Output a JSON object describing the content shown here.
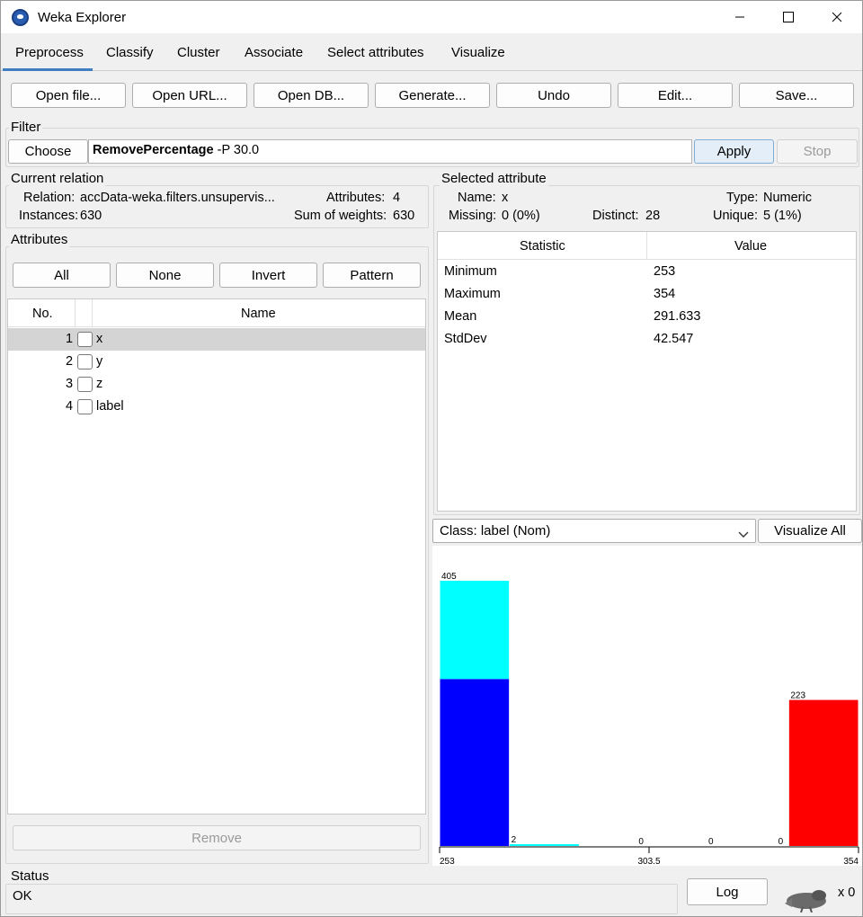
{
  "window": {
    "title": "Weka Explorer",
    "minimize_icon": "minimize-icon",
    "maximize_icon": "maximize-icon",
    "close_icon": "close-icon"
  },
  "tabs": [
    {
      "label": "Preprocess",
      "active": true
    },
    {
      "label": "Classify"
    },
    {
      "label": "Cluster"
    },
    {
      "label": "Associate"
    },
    {
      "label": "Select attributes"
    },
    {
      "label": "Visualize"
    }
  ],
  "toolbar": {
    "open_file": "Open file...",
    "open_url": "Open URL...",
    "open_db": "Open DB...",
    "generate": "Generate...",
    "undo": "Undo",
    "edit": "Edit...",
    "save": "Save..."
  },
  "filter": {
    "label": "Filter",
    "choose": "Choose",
    "name": "RemovePercentage",
    "options": " -P 30.0",
    "apply": "Apply",
    "stop": "Stop"
  },
  "current_relation": {
    "label": "Current relation",
    "relation_label": "Relation:",
    "relation": "accData-weka.filters.unsupervis...",
    "attributes_label": "Attributes:",
    "attributes": "4",
    "instances_label": "Instances:",
    "instances": "630",
    "sum_weights_label": "Sum of weights:",
    "sum_weights": "630"
  },
  "attributes_panel": {
    "label": "Attributes",
    "all": "All",
    "none": "None",
    "invert": "Invert",
    "pattern": "Pattern",
    "col_no": "No.",
    "col_name": "Name",
    "rows": [
      {
        "no": "1",
        "name": "x",
        "selected": true
      },
      {
        "no": "2",
        "name": "y"
      },
      {
        "no": "3",
        "name": "z"
      },
      {
        "no": "4",
        "name": "label"
      }
    ],
    "remove": "Remove"
  },
  "selected_attribute": {
    "label": "Selected attribute",
    "name_label": "Name:",
    "name": "x",
    "type_label": "Type:",
    "type": "Numeric",
    "missing_label": "Missing:",
    "missing": "0 (0%)",
    "distinct_label": "Distinct:",
    "distinct": "28",
    "unique_label": "Unique:",
    "unique": "5 (1%)",
    "col_statistic": "Statistic",
    "col_value": "Value",
    "stats": [
      {
        "statistic": "Minimum",
        "value": "253"
      },
      {
        "statistic": "Maximum",
        "value": "354"
      },
      {
        "statistic": "Mean",
        "value": "291.633"
      },
      {
        "statistic": "StdDev",
        "value": "42.547"
      }
    ]
  },
  "class_select": {
    "value": "Class: label (Nom)",
    "icon": "chevron-down-icon"
  },
  "visualize_all": "Visualize All",
  "chart_data": {
    "type": "bar",
    "stacked": true,
    "categories": [
      "bin1",
      "bin2",
      "bin3",
      "bin4",
      "bin5",
      "bin6"
    ],
    "bin_totals": [
      405,
      2,
      0,
      0,
      0,
      223
    ],
    "total_labels": [
      "405",
      "2",
      "0",
      "0",
      "0",
      "223"
    ],
    "series": [
      {
        "color": "#0000ff",
        "values": [
          255,
          0,
          0,
          0,
          0,
          0
        ]
      },
      {
        "color": "#00ffff",
        "values": [
          150,
          2,
          0,
          0,
          0,
          0
        ]
      },
      {
        "color": "#ff0000",
        "values": [
          0,
          0,
          0,
          0,
          0,
          223
        ]
      }
    ],
    "ymax": 405,
    "x_ticks": [
      "253",
      "303.5",
      "354"
    ]
  },
  "status": {
    "label": "Status",
    "text": "OK",
    "log": "Log",
    "count": "x 0",
    "icon": "weka-bird-icon"
  }
}
